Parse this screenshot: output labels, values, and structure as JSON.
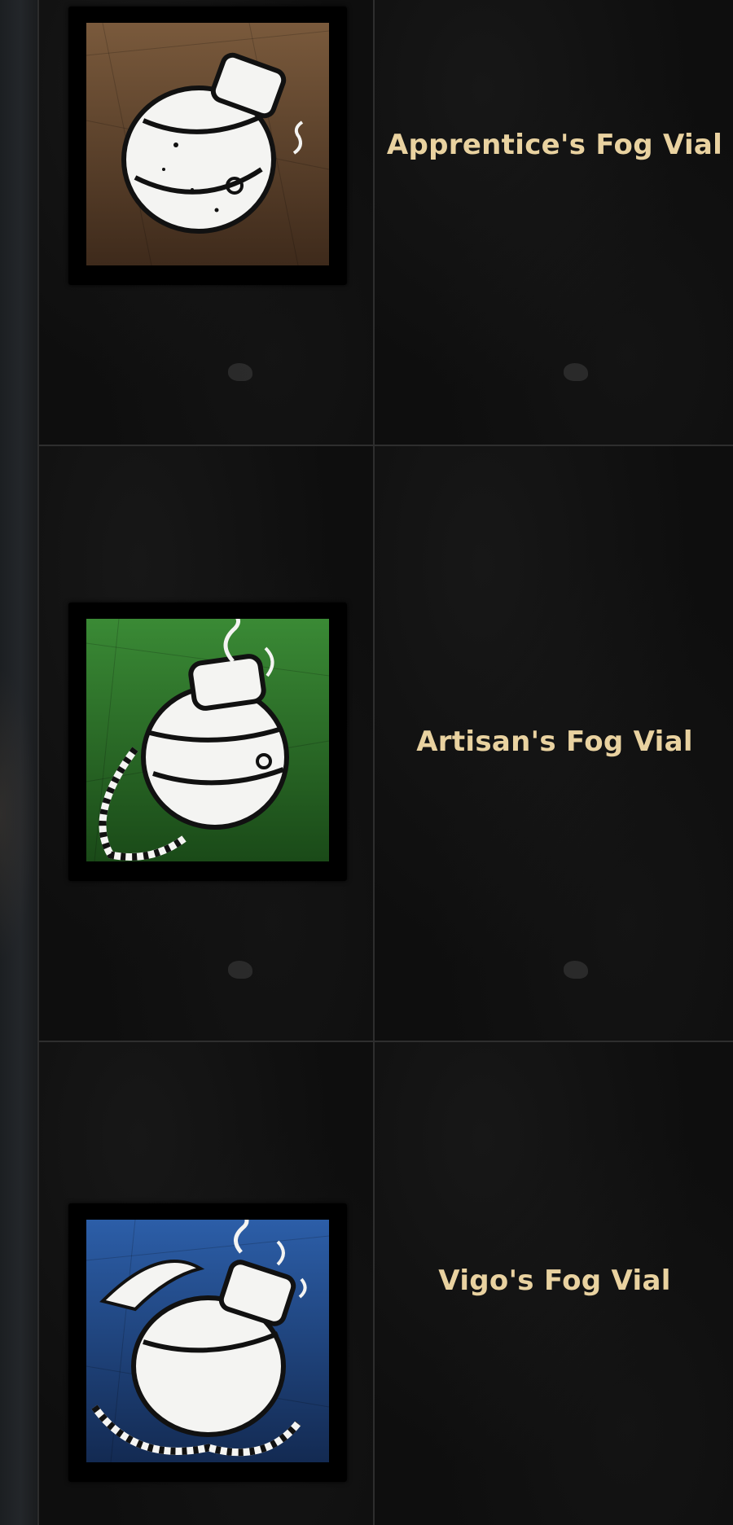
{
  "rows": [
    {
      "icon": "fog-vial-icon",
      "rarity_color": "#6e4f34",
      "name": "Apprentice's Fog Vial"
    },
    {
      "icon": "fog-vial-with-rope-icon",
      "rarity_color": "#2f7a2a",
      "name": "Artisan's Fog Vial"
    },
    {
      "icon": "fog-vial-with-feathers-icon",
      "rarity_color": "#1f4a8a",
      "name": "Vigo's Fog Vial"
    }
  ],
  "colors": {
    "name_text": "#e9d2a0",
    "background": "#0e0e0e",
    "grid_line": "#2e2e2e"
  }
}
